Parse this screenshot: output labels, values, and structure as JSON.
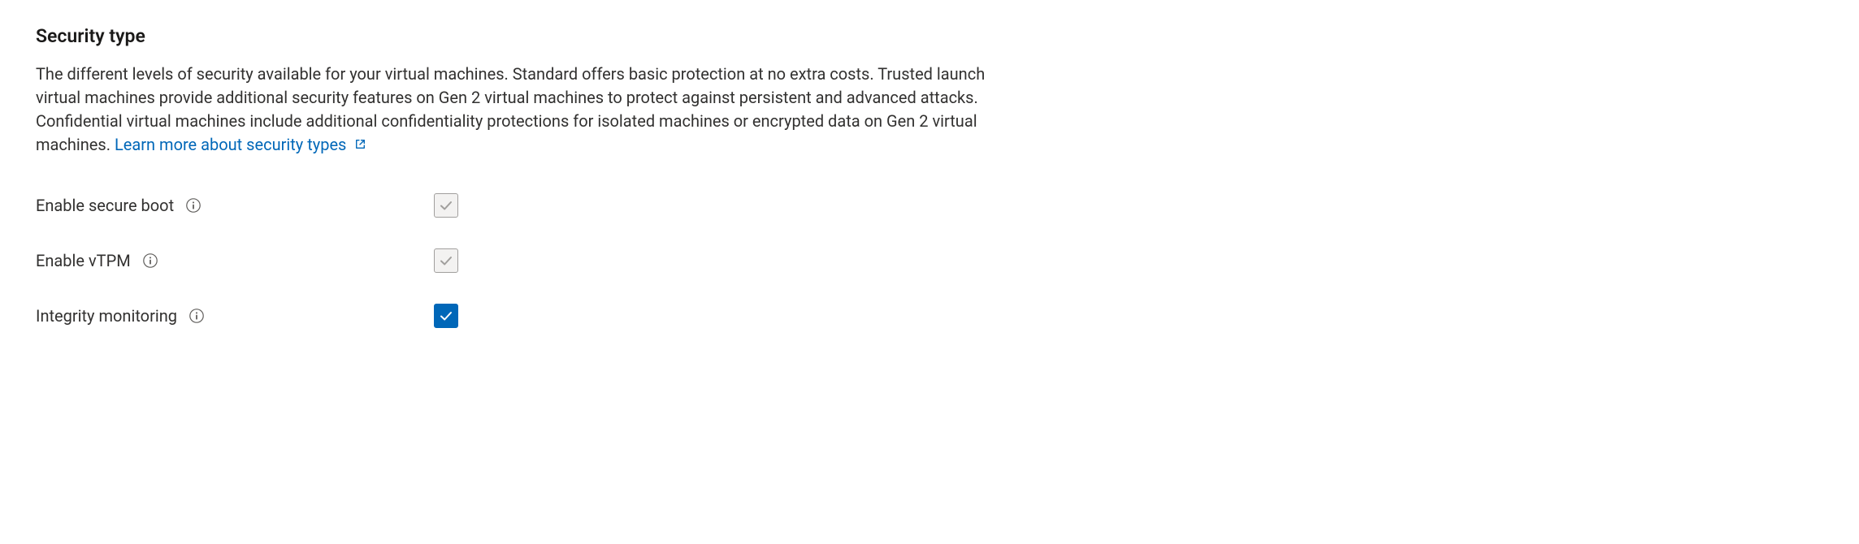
{
  "section": {
    "heading": "Security type",
    "description": "The different levels of security available for your virtual machines. Standard offers basic protection at no extra costs. Trusted launch virtual machines provide additional security features on Gen 2 virtual machines to protect against persistent and advanced attacks. Confidential virtual machines include additional confidentiality protections for isolated machines or encrypted data on Gen 2 virtual machines.",
    "link_text": "Learn more about security types"
  },
  "fields": {
    "secure_boot": {
      "label": "Enable secure boot",
      "checked": true,
      "disabled": true
    },
    "vtpm": {
      "label": "Enable vTPM",
      "checked": true,
      "disabled": true
    },
    "integrity": {
      "label": "Integrity monitoring",
      "checked": true,
      "disabled": false
    }
  },
  "colors": {
    "link": "#0067b8",
    "accent": "#0067b8",
    "text": "#323130"
  }
}
